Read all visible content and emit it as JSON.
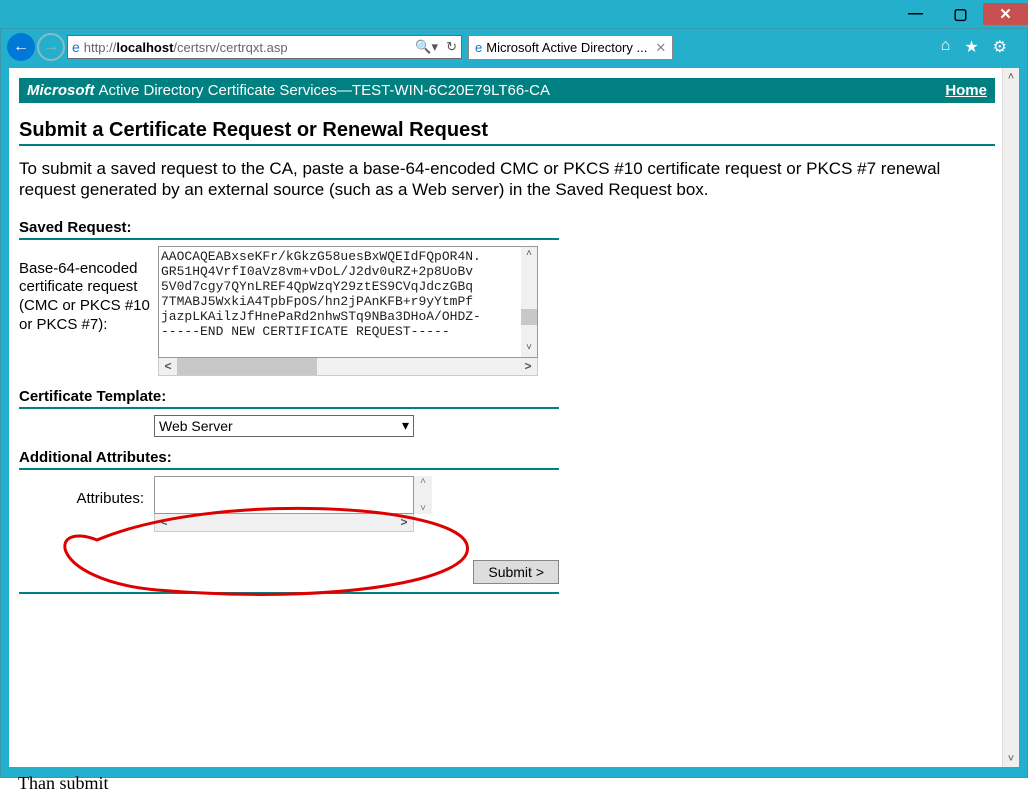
{
  "window": {
    "minimize": "—",
    "restore": "▢",
    "close": "✕"
  },
  "browser": {
    "url_prefix": "http://",
    "url_host": "localhost",
    "url_path": "/certsrv/certrqxt.asp",
    "tab_title": "Microsoft Active Directory ..."
  },
  "banner": {
    "microsoft": "Microsoft",
    "adcs": "Active Directory Certificate Services",
    "ca_sep": " — ",
    "ca_name": "TEST-WIN-6C20E79LT66-CA",
    "home": "Home"
  },
  "page": {
    "title": "Submit a Certificate Request or Renewal Request",
    "intro": "To submit a saved request to the CA, paste a base-64-encoded CMC or PKCS #10 certificate request or PKCS #7 renewal request generated by an external source (such as a Web server) in the Saved Request box."
  },
  "saved_request": {
    "section_title": "Saved Request:",
    "label": "Base-64-encoded certificate request (CMC or PKCS #10 or PKCS #7):",
    "text": "AAOCAQEABxseKFr/kGkzG58uesBxWQEIdFQpOR4N.\nGR51HQ4VrfI0aVz8vm+vDoL/J2dv0uRZ+2p8UoBv\n5V0d7cgy7QYnLREF4QpWzqY29ztES9CVqJdczGBq\n7TMABJ5WxkiA4TpbFpOS/hn2jPAnKFB+r9yYtmPf\njazpLKAilzJfHnePaRd2nhwSTq9NBa3DHoA/OHDZ-\n-----END NEW CERTIFICATE REQUEST-----"
  },
  "cert_template": {
    "section_title": "Certificate Template:",
    "selected": "Web Server"
  },
  "additional_attrs": {
    "section_title": "Additional Attributes:",
    "label": "Attributes:",
    "value": ""
  },
  "submit": {
    "label": "Submit >"
  },
  "footer_fragment": "Than submit"
}
